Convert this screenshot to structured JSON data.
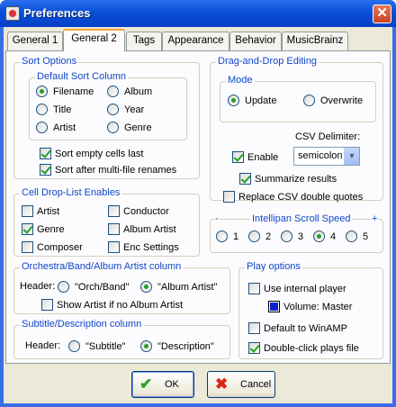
{
  "window": {
    "title": "Preferences",
    "close": "✕"
  },
  "tabs": [
    "General 1",
    "General 2",
    "Tags",
    "Appearance",
    "Behavior",
    "MusicBrainz"
  ],
  "sort_options": {
    "title": "Sort Options",
    "default_column": {
      "title": "Default Sort Column",
      "options": [
        "Filename",
        "Album",
        "Title",
        "Year",
        "Artist",
        "Genre"
      ],
      "selected": "Filename"
    },
    "sort_empty_last": "Sort empty cells last",
    "sort_after_rename": "Sort after multi-file renames"
  },
  "dnd": {
    "title": "Drag-and-Drop Editing",
    "mode": {
      "title": "Mode",
      "update": "Update",
      "overwrite": "Overwrite",
      "selected": "Update"
    },
    "enable": "Enable",
    "csv_label": "CSV Delimiter:",
    "csv_value": "semicolon",
    "summarize": "Summarize results",
    "replace_quotes": "Replace CSV double quotes"
  },
  "cell_dropdown": {
    "title": "Cell Drop-List Enables",
    "items": [
      {
        "label": "Artist",
        "checked": false
      },
      {
        "label": "Conductor",
        "checked": false
      },
      {
        "label": "Genre",
        "checked": true
      },
      {
        "label": "Album Artist",
        "checked": false
      },
      {
        "label": "Composer",
        "checked": false
      },
      {
        "label": "Enc Settings",
        "checked": false
      }
    ]
  },
  "scroll_speed": {
    "title": "Intellipan Scroll Speed",
    "minus": "-",
    "plus": "+",
    "options": [
      "1",
      "2",
      "3",
      "4",
      "5"
    ],
    "selected": "4"
  },
  "orchestra": {
    "title": "Orchestra/Band/Album Artist column",
    "header_label": "Header:",
    "opt1": "\"Orch/Band\"",
    "opt2": "\"Album Artist\"",
    "selected": "\"Album Artist\"",
    "show_artist": "Show Artist if no Album Artist"
  },
  "subtitle": {
    "title": "Subtitle/Description column",
    "header_label": "Header:",
    "opt1": "\"Subtitle\"",
    "opt2": "\"Description\"",
    "selected": "\"Description\""
  },
  "play": {
    "title": "Play options",
    "internal": "Use internal player",
    "volume": "Volume: Master",
    "winamp": "Default to WinAMP",
    "dblclick": "Double-click plays file"
  },
  "buttons": {
    "ok": "OK",
    "cancel": "Cancel"
  },
  "colors": {
    "titlebar": "#0a4fd8",
    "group_title": "#1046c8",
    "check": "#21a121"
  }
}
